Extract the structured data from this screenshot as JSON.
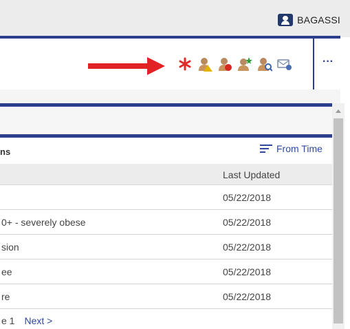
{
  "topbar": {
    "username": "BAGASSI",
    "user_icon": "person-badge-icon"
  },
  "header": {
    "more_label": "···",
    "alert_icons": [
      {
        "name": "red-asterisk-icon",
        "color": "#e02b2b"
      },
      {
        "name": "patient-warning-icon",
        "color": "#e3b300"
      },
      {
        "name": "patient-alert-icon",
        "color": "#d6281f"
      },
      {
        "name": "patient-star-icon",
        "color": "#2e9c3a"
      },
      {
        "name": "patient-search-icon",
        "color": "#3a63a8"
      },
      {
        "name": "message-card-icon",
        "color": "#4a6fb0"
      }
    ],
    "arrow_color": "#e02424"
  },
  "section": {
    "title": "ns",
    "sort_label": "From Time",
    "sort_icon": "sort-lines-icon"
  },
  "table": {
    "columns": [
      "",
      "Last Updated"
    ],
    "rows": [
      {
        "name": "",
        "updated": "05/22/2018"
      },
      {
        "name": "0+ - severely obese",
        "updated": "05/22/2018"
      },
      {
        "name": "sion",
        "updated": "05/22/2018"
      },
      {
        "name": "ee",
        "updated": "05/22/2018"
      },
      {
        "name": "re",
        "updated": "05/22/2018"
      }
    ]
  },
  "pager": {
    "page": "e 1",
    "next": "Next >"
  },
  "colors": {
    "brand_blue": "#2d3e8c",
    "link_blue": "#2f4aa0"
  }
}
